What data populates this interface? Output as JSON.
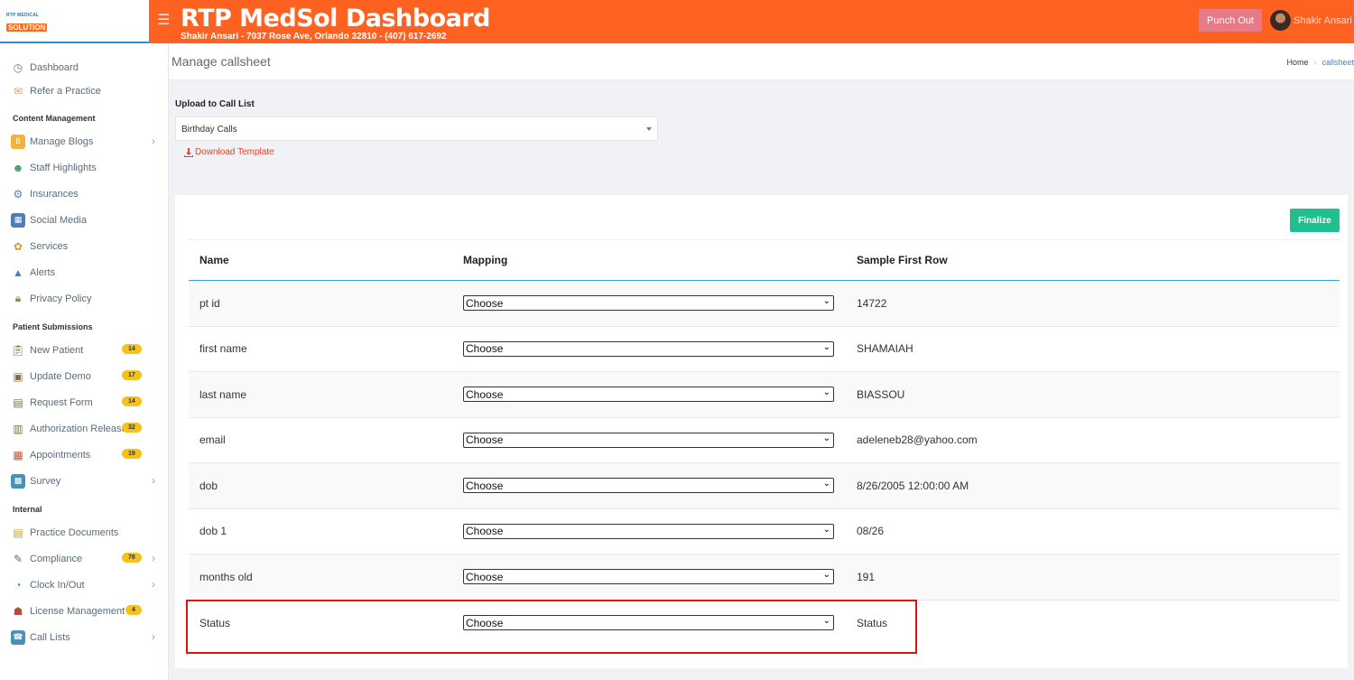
{
  "logo": {
    "line1": "RTP MEDICAL",
    "line2": "SOLUTION"
  },
  "header": {
    "title": "RTP MedSol Dashboard",
    "subtitle": "Shakir Ansari - 7037 Rose Ave, Orlando 32810 - (407) 617-2692",
    "punch_out": "Punch Out",
    "user_name": "Shakir Ansari"
  },
  "sidebar": {
    "top": [
      {
        "label": "Dashboard",
        "icon": "dashboard-icon"
      },
      {
        "label": "Refer a Practice",
        "icon": "refer-icon"
      }
    ],
    "sections": [
      {
        "title": "Content Management",
        "items": [
          {
            "label": "Manage Blogs",
            "chevron": true
          },
          {
            "label": "Staff Highlights"
          },
          {
            "label": "Insurances"
          },
          {
            "label": "Social Media"
          },
          {
            "label": "Services"
          },
          {
            "label": "Alerts"
          },
          {
            "label": "Privacy Policy"
          }
        ]
      },
      {
        "title": "Patient Submissions",
        "items": [
          {
            "label": "New Patient",
            "badge": "14"
          },
          {
            "label": "Update Demo",
            "badge": "17"
          },
          {
            "label": "Request Form",
            "badge": "14"
          },
          {
            "label": "Authorization Release",
            "badge": "32"
          },
          {
            "label": "Appointments",
            "badge": "19"
          },
          {
            "label": "Survey",
            "chevron": true
          }
        ]
      },
      {
        "title": "Internal",
        "items": [
          {
            "label": "Practice Documents"
          },
          {
            "label": "Compliance",
            "badge": "78",
            "chevron": true
          },
          {
            "label": "Clock In/Out",
            "chevron": true
          },
          {
            "label": "License Management",
            "badge": "4"
          },
          {
            "label": "Call Lists",
            "chevron": true
          }
        ]
      }
    ]
  },
  "page": {
    "title": "Manage callsheet",
    "breadcrumb": {
      "home": "Home",
      "current": "callsheet"
    }
  },
  "upload": {
    "label": "Upload to Call List",
    "selected": "Birthday Calls",
    "download": "Download Template"
  },
  "mapping": {
    "finalize": "Finalize",
    "headers": [
      "Name",
      "Mapping",
      "Sample First Row"
    ],
    "choose_label": "Choose",
    "rows": [
      {
        "name": "pt id",
        "sample": "14722"
      },
      {
        "name": "first name",
        "sample": "SHAMAIAH"
      },
      {
        "name": "last name",
        "sample": "BIASSOU"
      },
      {
        "name": "email",
        "sample": "adeleneb28@yahoo.com"
      },
      {
        "name": "dob",
        "sample": "8/26/2005 12:00:00 AM"
      },
      {
        "name": "dob 1",
        "sample": "08/26"
      },
      {
        "name": "months old",
        "sample": "191"
      },
      {
        "name": "Status",
        "sample": "Status"
      }
    ]
  },
  "colors": {
    "header": "#ff6121",
    "accent": "#2f8fd8",
    "finalize": "#1fbf8f",
    "badge": "#f4c21b",
    "highlight": "#e01313"
  }
}
